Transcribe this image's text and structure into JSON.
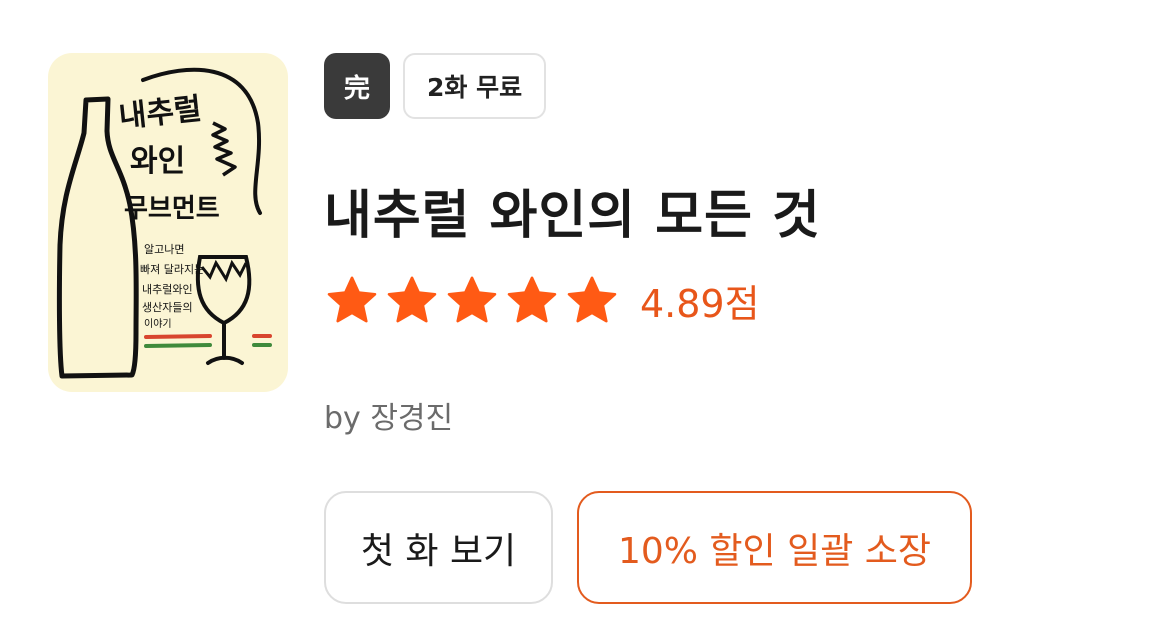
{
  "book": {
    "cover": {
      "title_lines": [
        "내추럴",
        "와인",
        "무브먼트"
      ],
      "subtitle_lines": [
        "알고나면",
        "빠져 달라지는",
        "내추럴와인",
        "생산자들의",
        "이야기"
      ],
      "colors": {
        "background": "#fbf5d4",
        "ink": "#111111",
        "red": "#d8452e",
        "green": "#3f8a3c"
      }
    },
    "badges": {
      "complete": "完",
      "free_episodes": "2화 무료"
    },
    "title": "내추럴 와인의 모든 것",
    "rating": {
      "value": 4.89,
      "stars": 5,
      "label": "4.89점"
    },
    "author": "by 장경진",
    "actions": {
      "first_episode": "첫 화 보기",
      "bulk_purchase": "10% 할인 일괄 소장"
    },
    "colors": {
      "accent": "#e35b1e",
      "star": "#ff5a14",
      "badge_dark": "#3a3a3a"
    }
  }
}
